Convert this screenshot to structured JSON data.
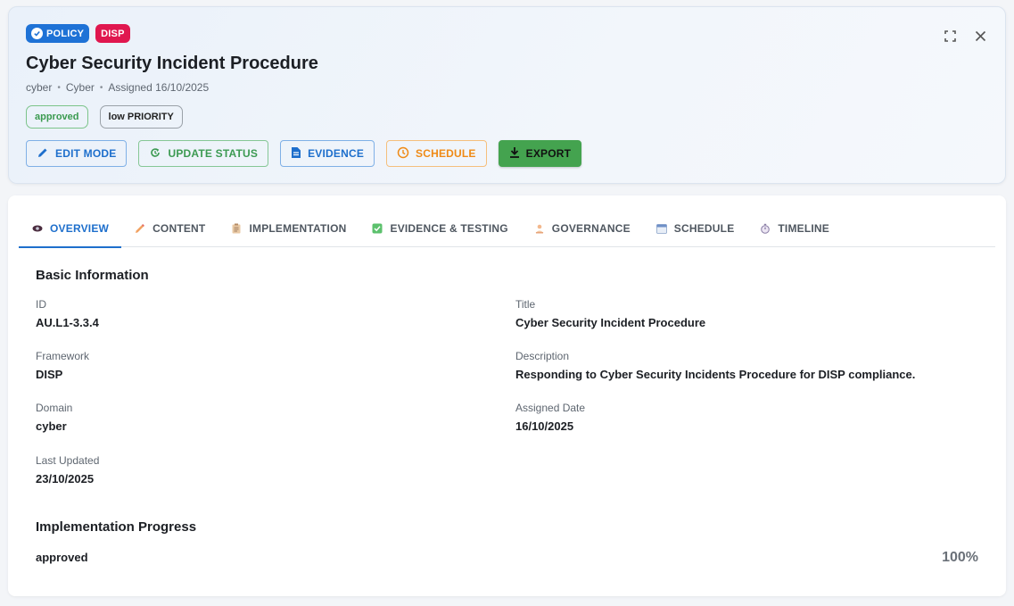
{
  "header": {
    "chip_policy": "POLICY",
    "chip_disp": "DISP",
    "title": "Cyber Security Incident Procedure",
    "meta": [
      "cyber",
      "Cyber",
      "Assigned 16/10/2025"
    ],
    "status": "approved",
    "priority": "low PRIORITY",
    "actions": {
      "edit": "EDIT MODE",
      "update": "UPDATE STATUS",
      "evidence": "EVIDENCE",
      "schedule": "SCHEDULE",
      "export": "EXPORT"
    },
    "colors": {
      "primary": "#1e72d6",
      "disp": "#e0174f",
      "success": "#44a34f",
      "warning": "#ef8a16"
    }
  },
  "tabs": [
    {
      "label": "OVERVIEW",
      "icon": "eye-icon",
      "active": true
    },
    {
      "label": "CONTENT",
      "icon": "pencil-icon"
    },
    {
      "label": "IMPLEMENTATION",
      "icon": "clipboard-icon"
    },
    {
      "label": "EVIDENCE & TESTING",
      "icon": "check-box-icon"
    },
    {
      "label": "GOVERNANCE",
      "icon": "governance-icon"
    },
    {
      "label": "SCHEDULE",
      "icon": "calendar-icon"
    },
    {
      "label": "TIMELINE",
      "icon": "stopwatch-icon"
    }
  ],
  "basic": {
    "heading": "Basic Information",
    "id_label": "ID",
    "id_value": "AU.L1-3.3.4",
    "framework_label": "Framework",
    "framework_value": "DISP",
    "domain_label": "Domain",
    "domain_value": "cyber",
    "updated_label": "Last Updated",
    "updated_value": "23/10/2025",
    "title_label": "Title",
    "title_value": "Cyber Security Incident Procedure",
    "desc_label": "Description",
    "desc_value": "Responding to Cyber Security Incidents Procedure for DISP compliance.",
    "assigned_label": "Assigned Date",
    "assigned_value": "16/10/2025"
  },
  "progress": {
    "heading": "Implementation Progress",
    "status": "approved",
    "percent": "100%"
  }
}
